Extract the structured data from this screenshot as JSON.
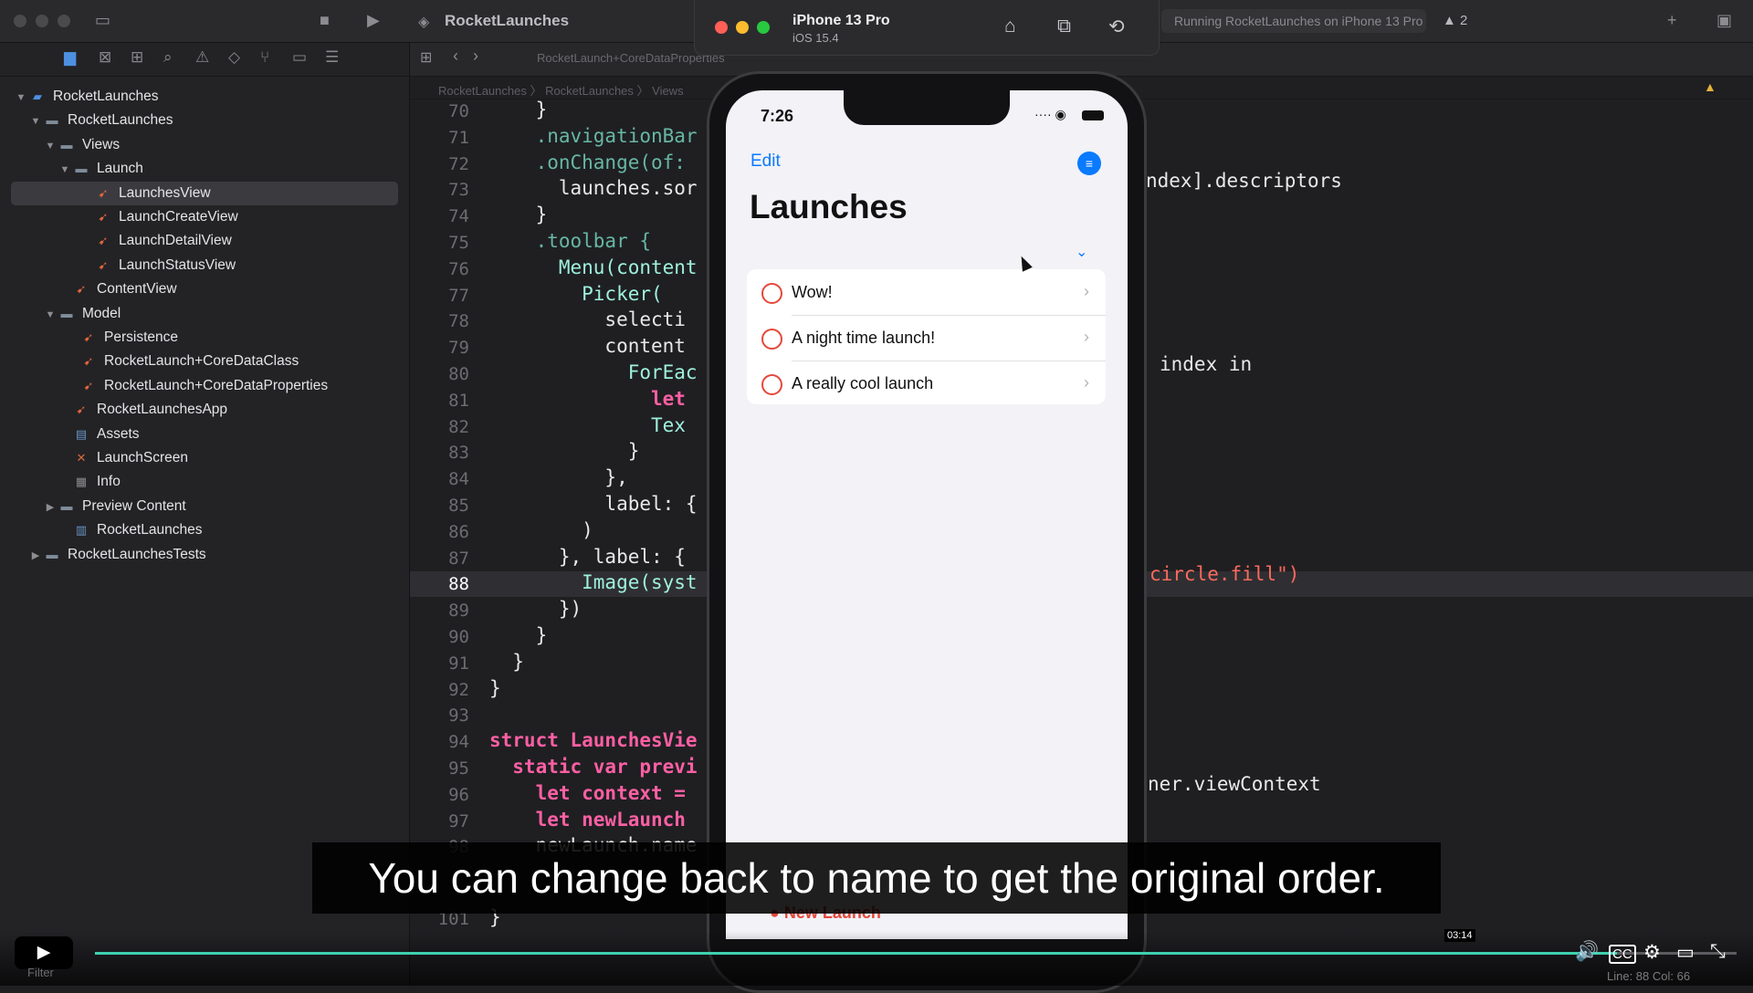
{
  "xcode": {
    "project_title": "RocketLaunches",
    "status_text": "Running RocketLaunches on iPhone 13 Pro",
    "warning_count": "2",
    "tab_label": "RocketLaunch+CoreDataProperties",
    "jump_path": "RocketLaunches 〉 RocketLaunches 〉 Views"
  },
  "navigator": {
    "items": [
      {
        "label": "RocketLaunches",
        "icon": "project-icon",
        "disc": "▼"
      },
      {
        "label": "RocketLaunches",
        "icon": "folder-icon",
        "disc": "▼"
      },
      {
        "label": "Views",
        "icon": "folder-icon",
        "disc": "▼"
      },
      {
        "label": "Launch",
        "icon": "folder-icon",
        "disc": "▼"
      },
      {
        "label": "LaunchesView",
        "icon": "swift-file-icon",
        "disc": ""
      },
      {
        "label": "LaunchCreateView",
        "icon": "swift-file-icon",
        "disc": ""
      },
      {
        "label": "LaunchDetailView",
        "icon": "swift-file-icon",
        "disc": ""
      },
      {
        "label": "LaunchStatusView",
        "icon": "swift-file-icon",
        "disc": ""
      },
      {
        "label": "ContentView",
        "icon": "swift-file-icon",
        "disc": ""
      },
      {
        "label": "Model",
        "icon": "folder-icon",
        "disc": "▼"
      },
      {
        "label": "Persistence",
        "icon": "swift-file-icon",
        "disc": ""
      },
      {
        "label": "RocketLaunch+CoreDataClass",
        "icon": "swift-file-icon",
        "disc": ""
      },
      {
        "label": "RocketLaunch+CoreDataProperties",
        "icon": "swift-file-icon",
        "disc": ""
      },
      {
        "label": "RocketLaunchesApp",
        "icon": "swift-file-icon",
        "disc": ""
      },
      {
        "label": "Assets",
        "icon": "assets-icon",
        "disc": ""
      },
      {
        "label": "LaunchScreen",
        "icon": "launch-screen-icon",
        "disc": ""
      },
      {
        "label": "Info",
        "icon": "info-plist-icon",
        "disc": ""
      },
      {
        "label": "Preview Content",
        "icon": "folder-icon",
        "disc": "▶"
      },
      {
        "label": "RocketLaunches",
        "icon": "entitlements-icon",
        "disc": ""
      },
      {
        "label": "RocketLaunchesTests",
        "icon": "folder-icon",
        "disc": "▶"
      }
    ],
    "filter_placeholder": "Filter"
  },
  "editor": {
    "line_numbers": [
      "70",
      "71",
      "72",
      "73",
      "74",
      "75",
      "76",
      "77",
      "78",
      "79",
      "80",
      "81",
      "82",
      "83",
      "84",
      "85",
      "86",
      "87",
      "88",
      "89",
      "90",
      "91",
      "92",
      "93",
      "94",
      "95",
      "96",
      "97",
      "98"
    ],
    "code_lines": [
      "    }",
      "    .navigationBar",
      "    .onChange(of:",
      "      launches.sor",
      "    }",
      "    .toolbar {",
      "      Menu(content",
      "        Picker(",
      "          selecti",
      "          content",
      "            ForEac",
      "              let",
      "              Tex",
      "            }",
      "          },",
      "          label: {",
      "        )",
      "      }, label: {",
      "        Image(syst",
      "      })",
      "    }",
      "  }",
      "}",
      "",
      "struct LaunchesVie",
      "  static var previ",
      "    let context =",
      "    let newLaunch",
      "    newLaunch.name"
    ],
    "right_snippets": {
      "line73": "ndex].descriptors",
      "line80": "index in",
      "line88": "circle.fill\")",
      "line96": "ner.viewContext"
    },
    "footer_line_number": "101",
    "cursor_position": "Line: 88  Col: 66"
  },
  "simulator": {
    "device": "iPhone 13 Pro",
    "os": "iOS 15.4",
    "time": "7:26",
    "edit_label": "Edit",
    "nav_title": "Launches",
    "launches": [
      "Wow!",
      "A night time launch!",
      "A really cool launch"
    ],
    "new_launch_label": "New Launch"
  },
  "player": {
    "caption": "You can change back to name to get the original order.",
    "timestamp": "03:14",
    "progress_fraction": 0.927
  }
}
